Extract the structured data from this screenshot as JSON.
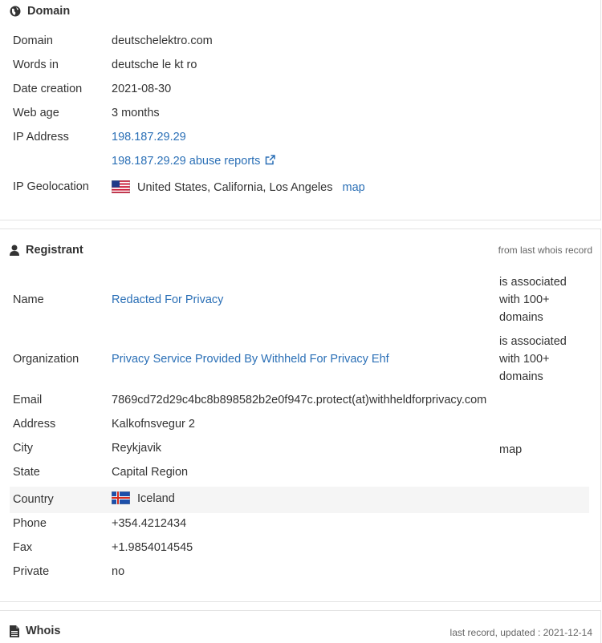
{
  "domain_section": {
    "title": "Domain",
    "rows": [
      {
        "label": "Domain",
        "value": "deutschelektro.com"
      },
      {
        "label": "Words in",
        "value": "deutsche le kt ro"
      },
      {
        "label": "Date creation",
        "value": "2021-08-30"
      },
      {
        "label": "Web age",
        "value": "3 months"
      },
      {
        "label": "IP Address",
        "value": "198.187.29.29"
      },
      {
        "label": "",
        "value": "198.187.29.29 abuse reports"
      },
      {
        "label": "IP Geolocation",
        "value": "United States, California, Los Angeles",
        "map": "map"
      }
    ]
  },
  "registrant_section": {
    "title": "Registrant",
    "note": "from last whois record",
    "rows": [
      {
        "label": "Name",
        "value": "Redacted For Privacy",
        "side_lines": [
          "is associated",
          "with 100+",
          "domains"
        ]
      },
      {
        "label": "Organization",
        "value": "Privacy Service Provided By Withheld For Privacy Ehf",
        "side_lines": [
          "is associated",
          "with 100+",
          "domains"
        ]
      },
      {
        "label": "Email",
        "value": "7869cd72d29c4bc8b898582b2e0f947c.protect(at)withheldforprivacy.com"
      },
      {
        "label": "Address",
        "value": "Kalkofnsvegur 2"
      },
      {
        "label": "City",
        "value": "Reykjavik",
        "map": "map"
      },
      {
        "label": "State",
        "value": "Capital Region"
      },
      {
        "label": "Country",
        "value": "Iceland"
      },
      {
        "label": "Phone",
        "value": "+354.4212434"
      },
      {
        "label": "Fax",
        "value": "+1.9854014545"
      },
      {
        "label": "Private",
        "value": "no"
      }
    ]
  },
  "whois_section": {
    "title": "Whois",
    "note": "last record, updated : 2021-12-14"
  },
  "icons": [
    "globe-icon",
    "external-link-icon",
    "us-flag-icon",
    "user-icon",
    "iceland-flag-icon",
    "document-icon"
  ],
  "colors": {
    "link": "#2a6fb6",
    "shade": "#f5f5f5",
    "border": "#e3e3e3"
  }
}
